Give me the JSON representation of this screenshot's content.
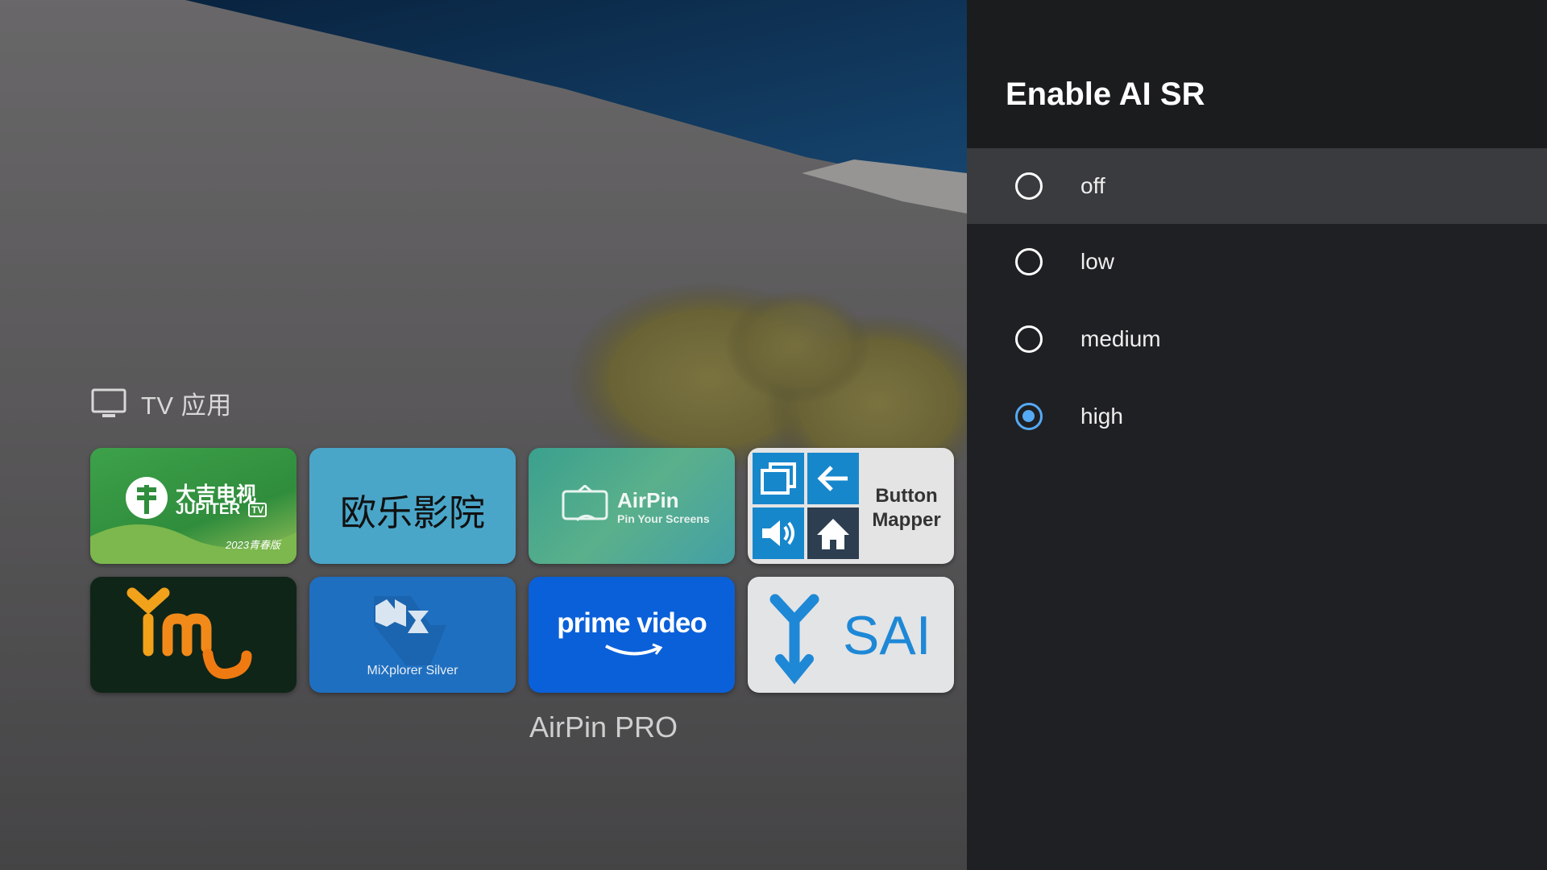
{
  "launcher": {
    "section_title": "TV 应用",
    "section_icon": "tv-icon",
    "focused_caption": "AirPin PRO",
    "apps": [
      {
        "id": "jupiter",
        "name": "大吉电视",
        "sub": "JUPITER",
        "badge": "TV",
        "edition": "2023青春版"
      },
      {
        "id": "oule",
        "name": "欧乐影院"
      },
      {
        "id": "airpin",
        "name": "AirPin",
        "sub": "Pin Your Screens"
      },
      {
        "id": "mapper",
        "line1": "Button",
        "line2": "Mapper"
      },
      {
        "id": "imu",
        "name": "imu"
      },
      {
        "id": "mix",
        "name": "MiXplorer Silver"
      },
      {
        "id": "prime",
        "name": "prime video"
      },
      {
        "id": "sai",
        "name": "SAI"
      }
    ]
  },
  "panel": {
    "title": "Enable AI SR",
    "options": [
      {
        "label": "off",
        "checked": false,
        "focused": true
      },
      {
        "label": "low",
        "checked": false,
        "focused": false
      },
      {
        "label": "medium",
        "checked": false,
        "focused": false
      },
      {
        "label": "high",
        "checked": true,
        "focused": false
      }
    ],
    "colors": {
      "accent": "#55aaf5",
      "panel_bg": "#1f2023",
      "focused_row": "#3a3b3e"
    }
  }
}
